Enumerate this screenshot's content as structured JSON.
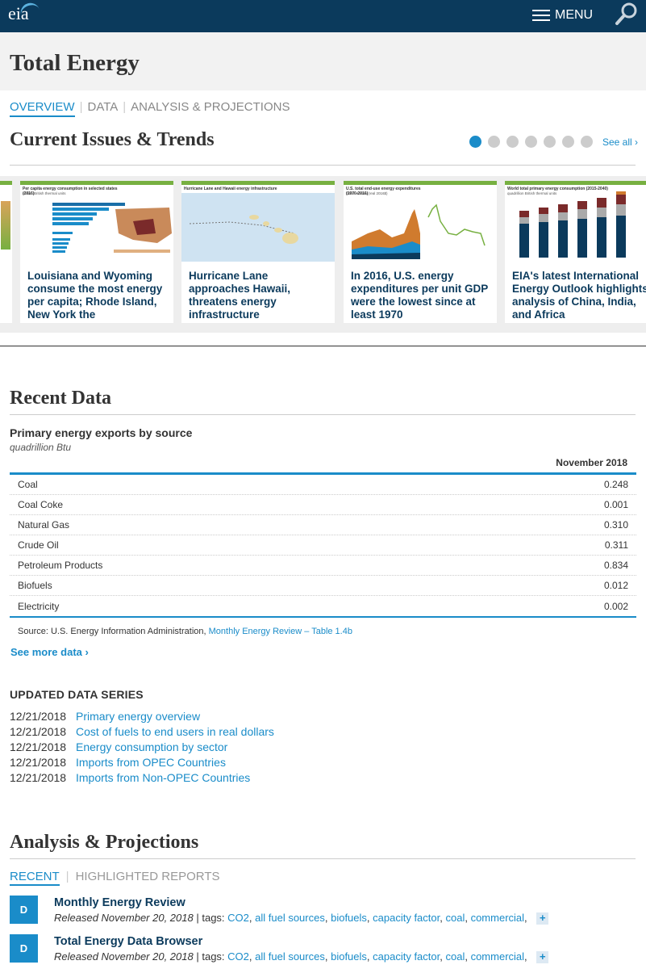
{
  "header": {
    "logo_text": "eia",
    "menu_label": "MENU"
  },
  "page_title": "Total Energy",
  "subnav": [
    {
      "label": "OVERVIEW",
      "active": true
    },
    {
      "label": "DATA",
      "active": false
    },
    {
      "label": "ANALYSIS & PROJECTIONS",
      "active": false
    }
  ],
  "trends": {
    "title": "Current Issues & Trends",
    "see_all": "See all ›",
    "cards": [
      {
        "headline": "Louisiana and Wyoming consume the most energy per capita; Rhode Island, New York the",
        "chart_title": "Per capita energy consumption in selected states (2016)",
        "chart_sub": "million British thermal units"
      },
      {
        "headline": "Hurricane Lane approaches Hawaii, threatens energy infrastructure",
        "chart_title": "Hurricane Lane and Hawaii energy infrastructure"
      },
      {
        "headline": "In 2016, U.S. energy expenditures per unit GDP were the lowest since at least 1970",
        "chart_title": "U.S. total end-use energy expenditures (1970-2016)",
        "chart_sub": "billion dollars (real 2016$)"
      },
      {
        "headline": "EIA's latest International Energy Outlook highlights analysis of China, India, and Africa",
        "chart_title": "World total primary energy consumption (2015-2040)",
        "chart_sub": "quadrillion British thermal units"
      }
    ]
  },
  "recent_data": {
    "title": "Recent Data",
    "table_title": "Primary energy exports by source",
    "unit": "quadrillion Btu",
    "column": "November 2018",
    "rows": [
      {
        "label": "Coal",
        "value": "0.248"
      },
      {
        "label": "Coal Coke",
        "value": "0.001"
      },
      {
        "label": "Natural Gas",
        "value": "0.310"
      },
      {
        "label": "Crude Oil",
        "value": "0.311"
      },
      {
        "label": "Petroleum Products",
        "value": "0.834"
      },
      {
        "label": "Biofuels",
        "value": "0.012"
      },
      {
        "label": "Electricity",
        "value": "0.002"
      }
    ],
    "source_prefix": "Source: U.S. Energy Information Administration,",
    "source_link": "Monthly Energy Review – Table 1.4b",
    "see_more": "See more data ›"
  },
  "updated_series": {
    "title": "UPDATED DATA SERIES",
    "items": [
      {
        "date": "12/21/2018",
        "label": "Primary energy overview"
      },
      {
        "date": "12/21/2018",
        "label": "Cost of fuels to end users in real dollars"
      },
      {
        "date": "12/21/2018",
        "label": "Energy consumption by sector"
      },
      {
        "date": "12/21/2018",
        "label": "Imports from OPEC Countries"
      },
      {
        "date": "12/21/2018",
        "label": "Imports from Non-OPEC Countries"
      }
    ]
  },
  "analysis": {
    "title": "Analysis & Projections",
    "tabs": [
      {
        "label": "RECENT",
        "active": true
      },
      {
        "label": "HIGHLIGHTED REPORTS",
        "active": false
      }
    ],
    "reports": [
      {
        "badge": "D",
        "title": "Monthly Energy Review",
        "released": "Released November 20, 2018",
        "tags_label": "| tags:",
        "tags": [
          "CO2",
          "all fuel sources",
          "biofuels",
          "capacity factor",
          "coal",
          "commercial"
        ]
      },
      {
        "badge": "D",
        "title": "Total Energy Data Browser",
        "released": "Released November 20, 2018",
        "tags_label": "| tags:",
        "tags": [
          "CO2",
          "all fuel sources",
          "biofuels",
          "capacity factor",
          "coal",
          "commercial"
        ]
      }
    ]
  },
  "colors": {
    "navy": "#0b3a5c",
    "accent": "#1a8cc9",
    "green": "#77b041"
  }
}
